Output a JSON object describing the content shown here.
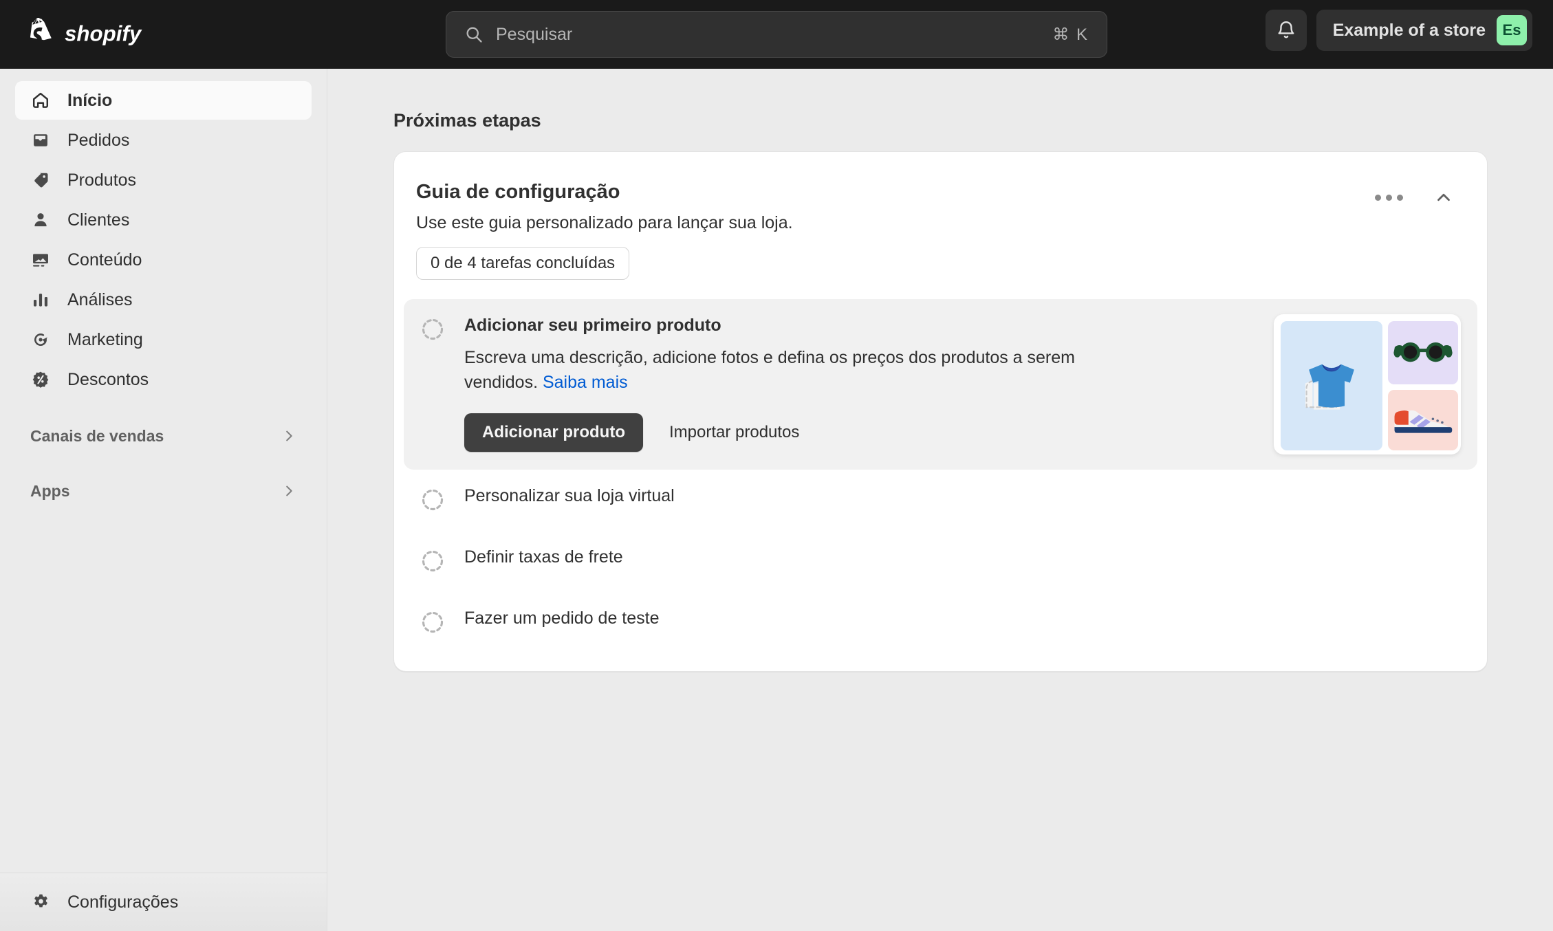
{
  "topbar": {
    "brand": "shopify",
    "logo_icon": "shopify-bag-icon",
    "search": {
      "placeholder": "Pesquisar",
      "icon": "search-icon",
      "shortcut": "⌘ K"
    },
    "notifications_icon": "bell-icon",
    "store": {
      "name": "Example of a store",
      "initials": "Es",
      "avatar_bg": "#8ef0ab",
      "avatar_fg": "#0c5132"
    }
  },
  "sidebar": {
    "items": [
      {
        "label": "Início",
        "icon": "home-icon",
        "active": true
      },
      {
        "label": "Pedidos",
        "icon": "orders-icon",
        "active": false
      },
      {
        "label": "Produtos",
        "icon": "tag-icon",
        "active": false
      },
      {
        "label": "Clientes",
        "icon": "person-icon",
        "active": false
      },
      {
        "label": "Conteúdo",
        "icon": "image-icon",
        "active": false
      },
      {
        "label": "Análises",
        "icon": "bar-chart-icon",
        "active": false
      },
      {
        "label": "Marketing",
        "icon": "target-icon",
        "active": false
      },
      {
        "label": "Descontos",
        "icon": "discount-icon",
        "active": false
      }
    ],
    "sections": [
      {
        "label": "Canais de vendas",
        "icon": "chevron-right-icon"
      },
      {
        "label": "Apps",
        "icon": "chevron-right-icon"
      }
    ],
    "settings": {
      "label": "Configurações",
      "icon": "gear-icon"
    }
  },
  "main": {
    "page_title": "Próximas etapas",
    "card": {
      "title": "Guia de configuração",
      "subtitle": "Use este guia personalizado para lançar sua loja.",
      "progress_label": "0 de 4 tarefas concluídas",
      "tasks_completed": 0,
      "tasks_total": 4,
      "more_icon": "ellipsis-icon",
      "collapse_icon": "chevron-up-icon",
      "tasks": [
        {
          "title": "Adicionar seu primeiro produto",
          "expanded": true,
          "status_icon": "incomplete-circle-icon",
          "description_before_link": "Escreva uma descrição, adicione fotos e defina os preços dos produtos a serem vendidos. ",
          "link_label": "Saiba mais",
          "primary_button": "Adicionar produto",
          "secondary_button": "Importar produtos",
          "illustration": {
            "tshirt": "tshirt-illustration",
            "sunglasses": "sunglasses-illustration",
            "sneaker": "sneaker-illustration"
          }
        },
        {
          "title": "Personalizar sua loja virtual",
          "expanded": false,
          "status_icon": "incomplete-circle-icon"
        },
        {
          "title": "Definir taxas de frete",
          "expanded": false,
          "status_icon": "incomplete-circle-icon"
        },
        {
          "title": "Fazer um pedido de teste",
          "expanded": false,
          "status_icon": "incomplete-circle-icon"
        }
      ]
    }
  },
  "colors": {
    "topbar_bg": "#1a1a1a",
    "app_bg": "#ebebeb",
    "card_bg": "#ffffff",
    "link": "#005bd3",
    "primary_button_bg": "#404040",
    "active_nav_bg": "#fafafa",
    "expanded_task_bg": "#f1f1f1"
  }
}
